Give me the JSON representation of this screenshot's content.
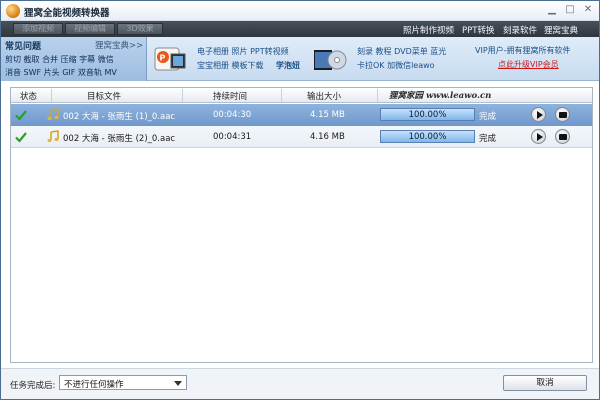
{
  "window": {
    "title": "狸窝全能视频转换器"
  },
  "toolbar": {
    "buttons": [
      "添加视频",
      "视频编辑",
      "3D效果"
    ],
    "links": [
      "照片制作视频",
      "PPT转换",
      "刻录软件",
      "狸窝宝典"
    ]
  },
  "banner": {
    "faq_title": "常见问题",
    "faq_more": "狸窝宝典>>",
    "faq_lines": [
      "剪切 截取 合并 压缩 字幕 微信",
      "消音 SWF 片头 GIF 双音轨 MV"
    ],
    "ad1_line1": "电子相册 照片 PPT转视频",
    "ad1_line2a": "宝宝相册 模板下载 ",
    "ad1_line2b": "学泡妞",
    "ad2_line1": "刻录 教程 DVD菜单 蓝光",
    "ad2_line2": "卡拉OK 加微信leawo",
    "vip_text": "VIP用户-拥有狸窝所有软件",
    "vip_link": "点此升级VIP会员"
  },
  "table": {
    "headers": [
      "状态",
      "目标文件",
      "持续时间",
      "输出大小"
    ],
    "watermark": "狸窝家园 www.leawo.cn",
    "rows": [
      {
        "file": "002 大海 - 张雨生 (1)_0.aac",
        "duration": "00:04:30",
        "size": "4.15 MB",
        "progress_label": "100.00%",
        "progress": 100,
        "status": "完成"
      },
      {
        "file": "002 大海 - 张雨生 (2)_0.aac",
        "duration": "00:04:31",
        "size": "4.16 MB",
        "progress_label": "100.00%",
        "progress": 100,
        "status": "完成"
      }
    ]
  },
  "footer": {
    "label": "任务完成后:",
    "select_value": "不进行任何操作",
    "cancel_label": "取消"
  },
  "colors": {
    "accent": "#6f98cb",
    "vip_link": "#cc1a1a",
    "check": "#2aa02a"
  }
}
